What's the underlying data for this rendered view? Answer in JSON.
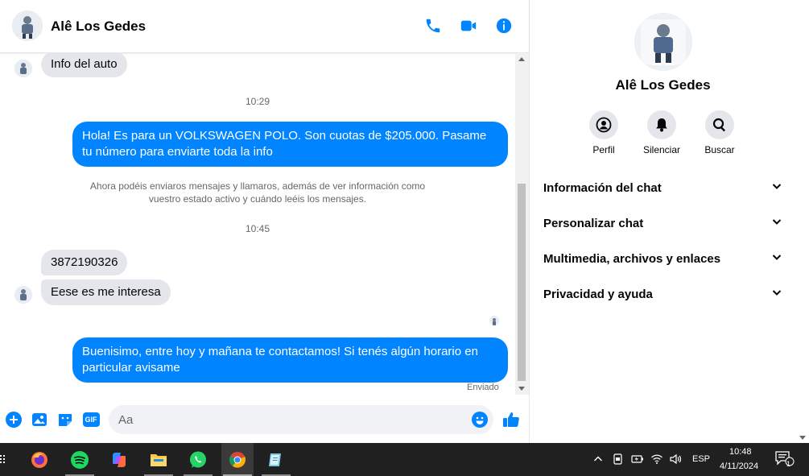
{
  "header": {
    "contact_name": "Alê Los Gedes"
  },
  "messages": {
    "m1": "Info del auto",
    "ts1": "10:29",
    "m2": "Hola! Es para un VOLKSWAGEN POLO. Son cuotas de $205.000. Pasame tu número para enviarte toda la info",
    "sys_line1": "Ahora podéis enviaros mensajes y llamaros, además de ver información como",
    "sys_line2": "vuestro estado activo y cuándo leéis los mensajes.",
    "ts2": "10:45",
    "m3": "3872190326",
    "m4": "Eese es me interesa",
    "m5": "Buenisimo, entre hoy y mañana te contactamos! Si tenés algún horario en particular avisame",
    "status": "Enviado"
  },
  "composer": {
    "placeholder": "Aa",
    "gif_label": "GIF"
  },
  "info_panel": {
    "name": "Alê Los Gedes",
    "actions": [
      {
        "label": "Perfil",
        "icon": "profile-icon"
      },
      {
        "label": "Silenciar",
        "icon": "bell-icon"
      },
      {
        "label": "Buscar",
        "icon": "search-icon"
      }
    ],
    "sections": [
      {
        "label": "Información del chat"
      },
      {
        "label": "Personalizar chat"
      },
      {
        "label": "Multimedia, archivos y enlaces"
      },
      {
        "label": "Privacidad y ayuda"
      }
    ]
  },
  "taskbar": {
    "lang": "ESP",
    "time": "10:48",
    "date": "4/11/2024",
    "notifications": "1"
  },
  "colors": {
    "accent": "#0084ff",
    "bubble_in": "#e4e6eb",
    "taskbar": "#202020"
  }
}
